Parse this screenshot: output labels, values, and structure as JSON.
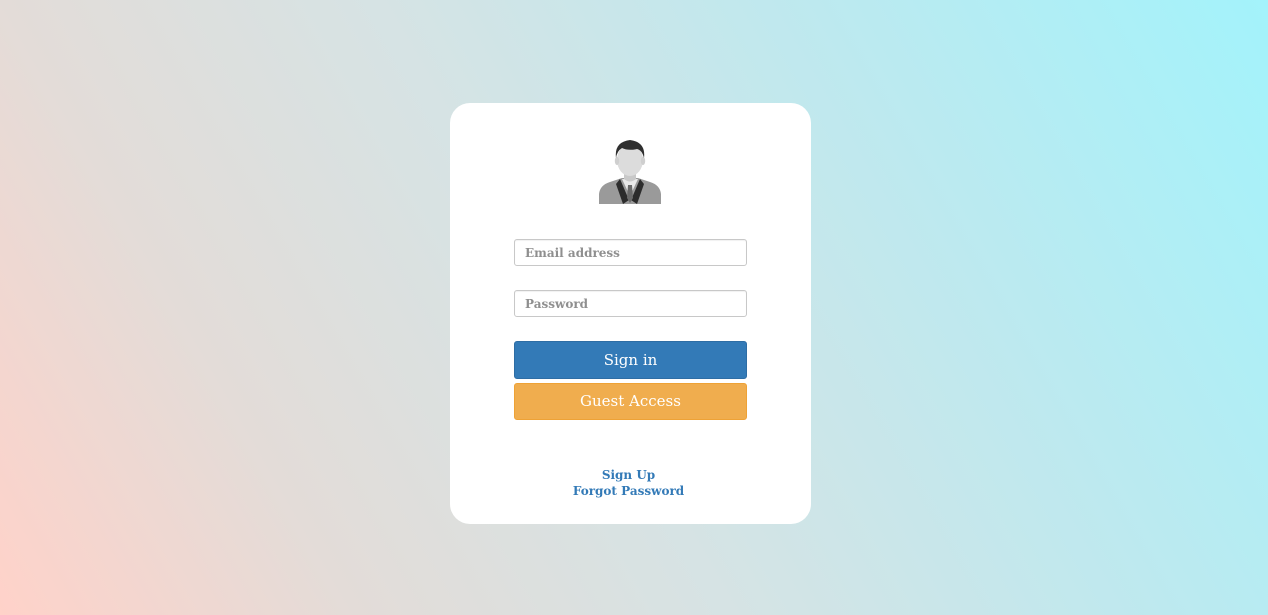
{
  "login": {
    "avatar_icon": "user-avatar-icon",
    "email_placeholder": "Email address",
    "password_placeholder": "Password",
    "signin_label": "Sign in",
    "guest_label": "Guest Access",
    "signup_link": "Sign Up",
    "forgot_link": "Forgot Password"
  },
  "colors": {
    "primary": "#337ab7",
    "warning": "#f0ad4e",
    "card": "#ffffff",
    "gradient_start": "#ffd2c9",
    "gradient_end": "#a3f3fb"
  }
}
